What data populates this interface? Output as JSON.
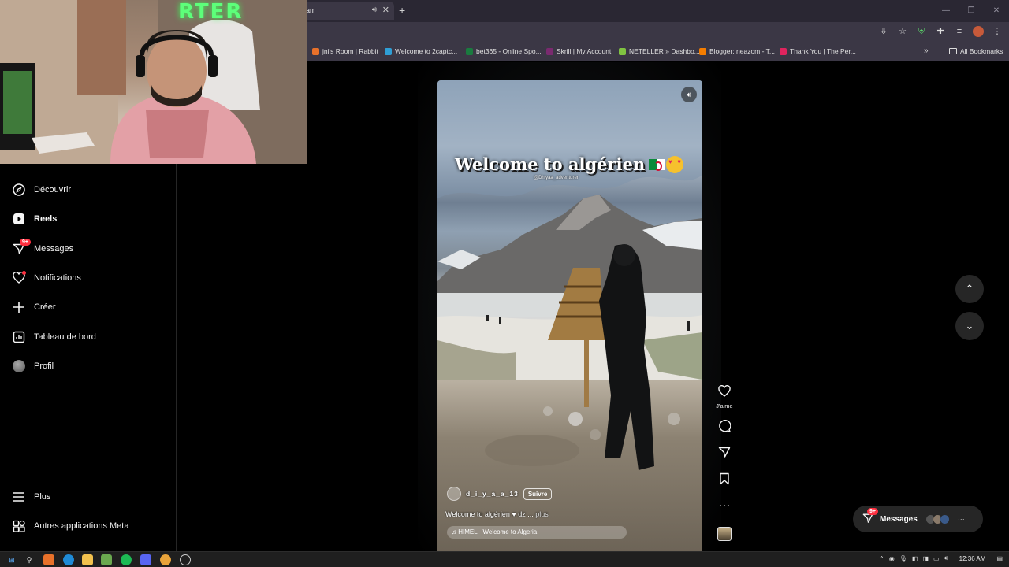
{
  "browser": {
    "active_tab_label": "am",
    "bookmarks": [
      {
        "label": "jni's Room | Rabbit",
        "color": "#e8712a"
      },
      {
        "label": "Welcome to 2captc...",
        "color": "#2f9fd6"
      },
      {
        "label": "bet365 - Online Spo...",
        "color": "#1a7b3f"
      },
      {
        "label": "Skrill | My Account",
        "color": "#7a2a6f"
      },
      {
        "label": "NETELLER » Dashbo...",
        "color": "#80c341"
      },
      {
        "label": "Blogger: neazom - T...",
        "color": "#f57d00"
      },
      {
        "label": "Thank You | The Per...",
        "color": "#e0245e"
      }
    ],
    "all_bookmarks_label": "All Bookmarks"
  },
  "sidebar": {
    "items": [
      {
        "label": "Découvrir",
        "icon": "compass-icon"
      },
      {
        "label": "Reels",
        "icon": "reels-icon"
      },
      {
        "label": "Messages",
        "icon": "messenger-icon",
        "badge": "9+"
      },
      {
        "label": "Notifications",
        "icon": "heart-icon"
      },
      {
        "label": "Créer",
        "icon": "plus-icon"
      },
      {
        "label": "Tableau de bord",
        "icon": "dashboard-icon"
      },
      {
        "label": "Profil",
        "icon": "avatar"
      }
    ],
    "bottom": [
      {
        "label": "Plus",
        "icon": "menu-icon"
      },
      {
        "label": "Autres applications Meta",
        "icon": "meta-icon"
      }
    ]
  },
  "reel": {
    "overlay_title": "Welcome to algérien",
    "watermark": "@Dhiyaa_adventurer",
    "author": "d_i_y_a_a_13",
    "follow_label": "Suivre",
    "caption": "Welcome to algérien ♥ dz ...",
    "caption_more": "plus",
    "audio": "♫ HIMEL · Welcome to Algeria"
  },
  "actions": {
    "like_label": "J'aime"
  },
  "dock": {
    "label": "Messages",
    "badge": "9+"
  },
  "webcam": {
    "neon_text": "RTER"
  },
  "taskbar": {
    "time": "12:36 AM"
  }
}
